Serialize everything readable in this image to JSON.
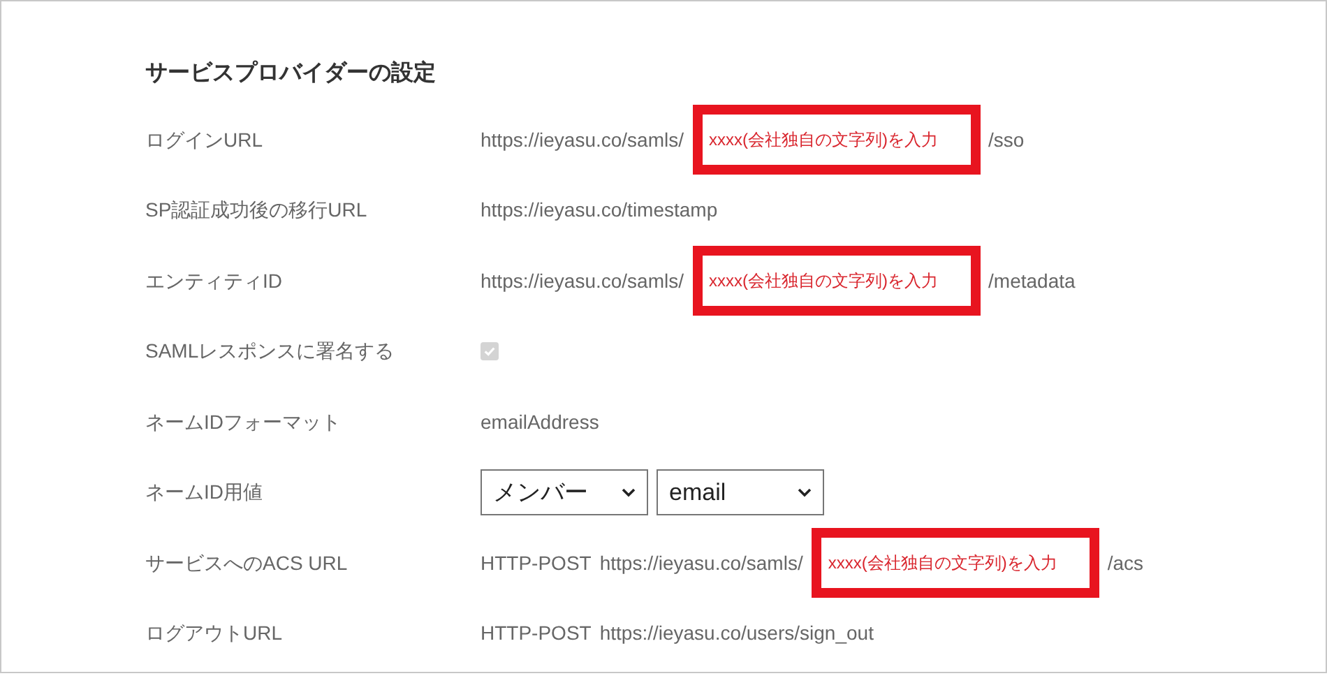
{
  "title": "サービスプロバイダーの設定",
  "rows": [
    {
      "label": "ログインURL",
      "parts": [
        {
          "kind": "text",
          "text": "https://ieyasu.co/samls/"
        },
        {
          "kind": "note",
          "text": "xxxx(会社独自の文字列)を入力"
        },
        {
          "kind": "text",
          "text": "/sso"
        }
      ]
    },
    {
      "label": "SP認証成功後の移行URL",
      "parts": [
        {
          "kind": "text",
          "text": "https://ieyasu.co/timestamp"
        }
      ]
    },
    {
      "label": "エンティティID",
      "parts": [
        {
          "kind": "text",
          "text": "https://ieyasu.co/samls/"
        },
        {
          "kind": "note",
          "text": "xxxx(会社独自の文字列)を入力"
        },
        {
          "kind": "text",
          "text": "/metadata"
        }
      ]
    },
    {
      "label": "SAMLレスポンスに署名する",
      "parts": [
        {
          "kind": "checkbox",
          "checked": true,
          "disabled": true
        }
      ]
    },
    {
      "label": "ネームIDフォーマット",
      "parts": [
        {
          "kind": "text",
          "text": "emailAddress"
        }
      ]
    },
    {
      "label": "ネームID用値",
      "parts": [
        {
          "kind": "select",
          "value": "メンバー"
        },
        {
          "kind": "select",
          "value": "email"
        }
      ]
    },
    {
      "label": "サービスへのACS URL",
      "parts": [
        {
          "kind": "text",
          "text": "HTTP-POST"
        },
        {
          "kind": "text",
          "text": "https://ieyasu.co/samls/"
        },
        {
          "kind": "note",
          "text": "xxxx(会社独自の文字列)を入力"
        },
        {
          "kind": "text",
          "text": "/acs"
        }
      ]
    },
    {
      "label": "ログアウトURL",
      "parts": [
        {
          "kind": "text",
          "text": "HTTP-POST"
        },
        {
          "kind": "text",
          "text": "https://ieyasu.co/users/sign_out"
        }
      ]
    }
  ]
}
